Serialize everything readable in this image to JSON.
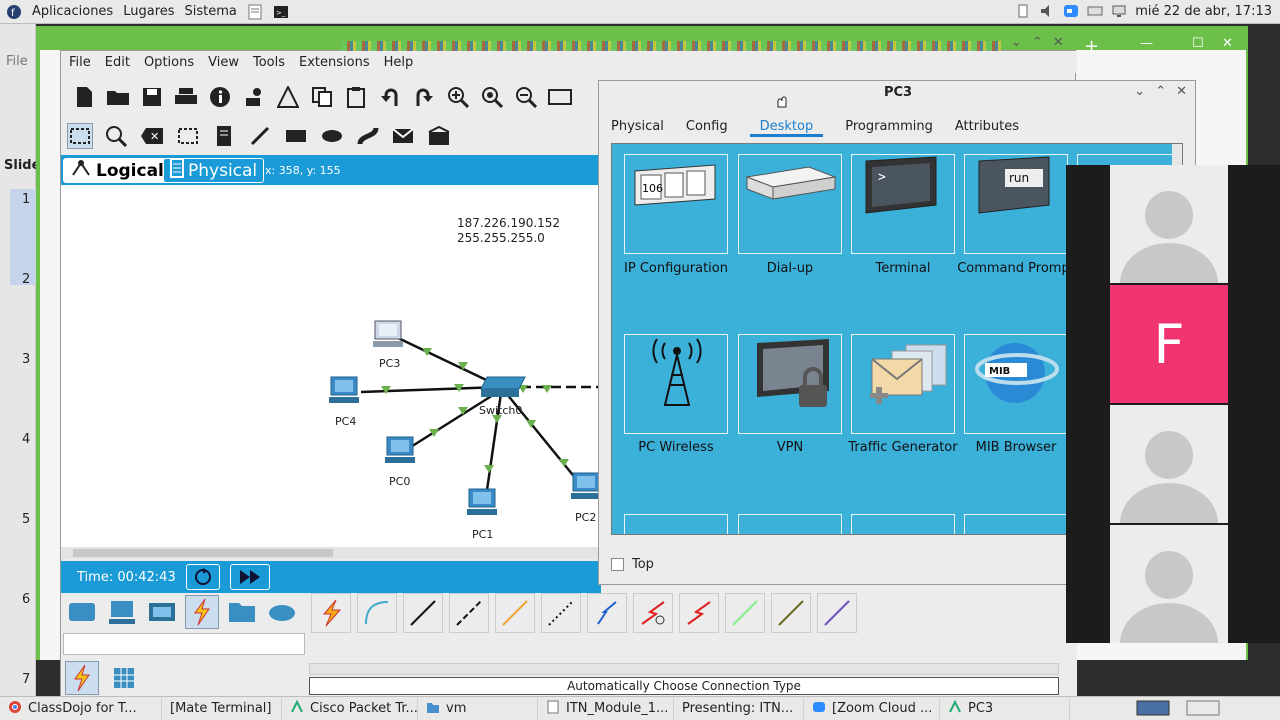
{
  "system_bar": {
    "menus": [
      "Aplicaciones",
      "Lugares",
      "Sistema"
    ],
    "clock": "mié 22 de abr, 17:13"
  },
  "background_app": {
    "file_label": "File",
    "slide_label": "Slide",
    "slide_numbers": [
      "1",
      "2",
      "3",
      "4",
      "5",
      "6",
      "7"
    ]
  },
  "packet_tracer": {
    "menu": [
      "File",
      "Edit",
      "Options",
      "View",
      "Tools",
      "Extensions",
      "Help"
    ],
    "tabs": {
      "logical": "Logical",
      "physical": "Physical",
      "coords": "x: 358, y: 155"
    },
    "canvas_note": [
      "187.226.190.152",
      "255.255.255.0"
    ],
    "devices": {
      "pc3": "PC3",
      "pc4": "PC4",
      "pc0": "PC0",
      "pc1": "PC1",
      "pc2": "PC2",
      "switch": "Switch0"
    },
    "time": "Time: 00:42:43",
    "status": "Automatically Choose Connection Type"
  },
  "pc3_dialog": {
    "title": "PC3",
    "tabs": [
      "Physical",
      "Config",
      "Desktop",
      "Programming",
      "Attributes"
    ],
    "active_tab": "Desktop",
    "apps": [
      {
        "label": "IP Configuration",
        "icon": "ip-config-icon"
      },
      {
        "label": "Dial-up",
        "icon": "dialup-icon"
      },
      {
        "label": "Terminal",
        "icon": "terminal-icon"
      },
      {
        "label": "Command Prompt",
        "icon": "command-prompt-icon"
      },
      {
        "label": "PC Wireless",
        "icon": "wireless-icon"
      },
      {
        "label": "VPN",
        "icon": "vpn-icon"
      },
      {
        "label": "Traffic Generator",
        "icon": "traffic-generator-icon"
      },
      {
        "label": "MIB Browser",
        "icon": "mib-browser-icon"
      }
    ],
    "ip_icon_text": "106",
    "run_icon_text": "run",
    "mib_icon_text": "MIB",
    "top_checkbox": "Top"
  },
  "zoom": {
    "participant_initial": "F",
    "accent": "#f0346f"
  },
  "taskbar": [
    "ClassDojo for T...",
    "[Mate Terminal]",
    "Cisco Packet Tr...",
    "vm",
    "ITN_Module_1...",
    "Presenting: ITN...",
    "[Zoom Cloud ...",
    "PC3"
  ]
}
